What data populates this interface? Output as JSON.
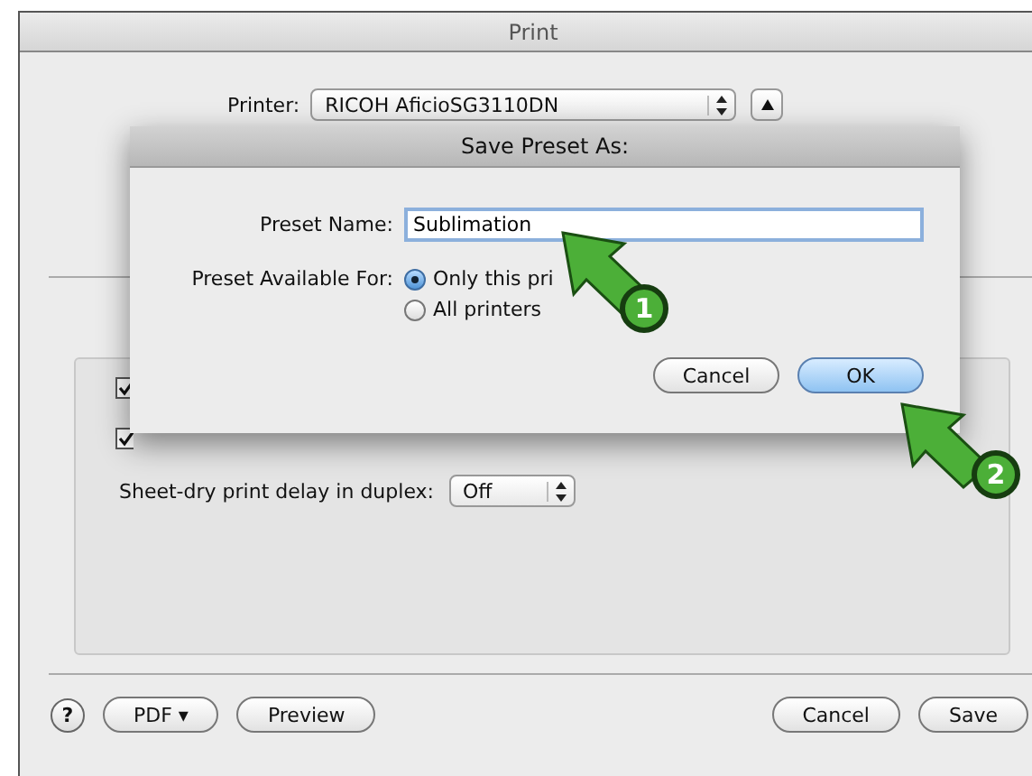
{
  "window": {
    "title": "Print"
  },
  "printer": {
    "label": "Printer:",
    "value": "RICOH AficioSG3110DN"
  },
  "options": {
    "checkboxes": [
      {
        "checked": true
      },
      {
        "checked": true
      }
    ],
    "delay_label": "Sheet-dry print delay in duplex:",
    "delay_value": "Off"
  },
  "bottom_buttons": {
    "help": "?",
    "pdf": "PDF ▾",
    "preview": "Preview",
    "cancel": "Cancel",
    "save": "Save"
  },
  "dialog": {
    "title": "Save Preset As:",
    "name_label": "Preset Name:",
    "name_value": "Sublimation",
    "available_label": "Preset Available For:",
    "radios": [
      {
        "label": "Only this pri",
        "selected": true
      },
      {
        "label": "All printers",
        "selected": false
      }
    ],
    "buttons": [
      {
        "label": "Cancel",
        "default": false
      },
      {
        "label": "OK",
        "default": true
      }
    ]
  },
  "callouts": [
    {
      "number": "1"
    },
    {
      "number": "2"
    }
  ]
}
